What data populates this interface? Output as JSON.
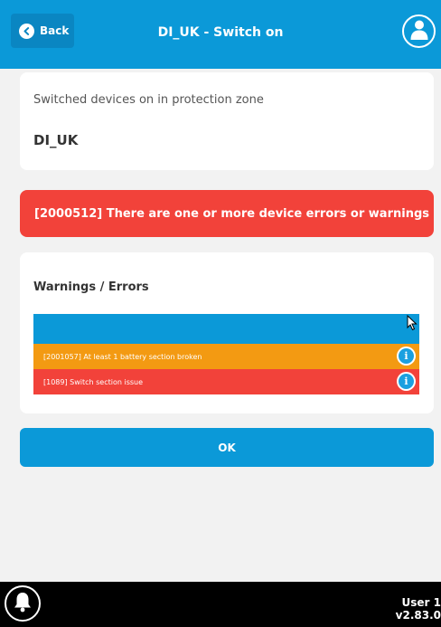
{
  "header": {
    "back_label": "Back",
    "title": "DI_UK - Switch on",
    "back_icon": "chevron-left-icon",
    "user_icon": "user-icon"
  },
  "info": {
    "description": "Switched devices on in protection zone",
    "zone": "DI_UK"
  },
  "error_banner": {
    "text": "[2000512] There are one or more device errors or warnings"
  },
  "warnings": {
    "title": "Warnings / Errors",
    "rows": [
      {
        "text": "[2001057] At least 1 battery section broken",
        "color": "#f39a12",
        "icon": "info-icon"
      },
      {
        "text": "[1089] Switch section issue",
        "color": "#f2423a",
        "icon": "info-icon"
      }
    ]
  },
  "ok_label": "OK",
  "footer": {
    "bell_icon": "bell-icon",
    "user": "User 1",
    "version": "v2.83.0"
  },
  "colors": {
    "primary": "#0b99d8",
    "error": "#f2423a",
    "warning": "#f39a12",
    "background": "#f2f2f2"
  }
}
